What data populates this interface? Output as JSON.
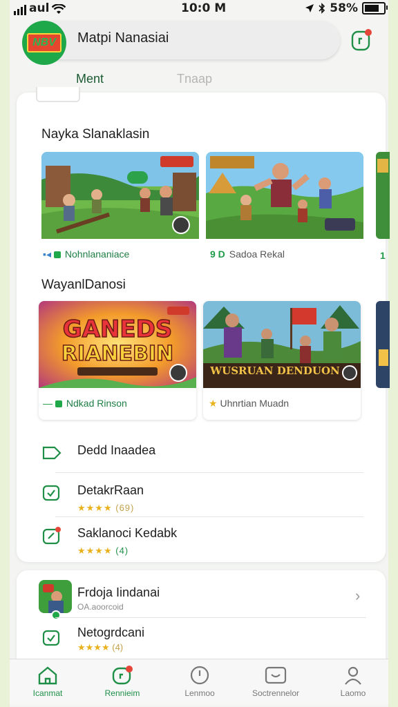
{
  "status_bar": {
    "carrier": "aul",
    "time": "10:0 M",
    "battery": "58%"
  },
  "header": {
    "title": "Matpi Nanasiai",
    "logo_text": "NBV"
  },
  "tabs": [
    {
      "label": "Ment",
      "active": true
    },
    {
      "label": "Tnaap",
      "active": false
    }
  ],
  "section1": {
    "title": "Nayka Slanaklasin",
    "tiles": [
      {
        "label": "Nohnlananiace",
        "badge": "GG",
        "style": "green"
      },
      {
        "label": "Sadoa Rekal",
        "prefix": "9 D",
        "style": "gray"
      }
    ],
    "partial_label": "1"
  },
  "section2": {
    "title": "WayanlDanosi",
    "tiles": [
      {
        "label": "Ndkad Rinson",
        "art_text_1": "GANEDS",
        "art_text_2": "RIANEBIN"
      },
      {
        "label": "Uhnrtian Muadn",
        "art_text": "WUSRUAN DENDUON"
      }
    ]
  },
  "list": [
    {
      "title": "Dedd Inaadea",
      "rating": ""
    },
    {
      "title": "DetakrRaan",
      "rating": "★★★★",
      "rating_suffix": "(69)"
    },
    {
      "title": "Saklanoci Kedabk",
      "rating": "★★★★",
      "rating_suffix": "(4)"
    }
  ],
  "card2": {
    "items": [
      {
        "title": "Frdoja Iindanai",
        "subtitle": "OA.aoorcoid"
      },
      {
        "title": "Netogrdcani",
        "rating": "★★★★",
        "rating_suffix": "(4)"
      }
    ]
  },
  "nav": [
    {
      "label": "Icanmat",
      "icon": "home-icon",
      "active": true
    },
    {
      "label": "Rennieim",
      "icon": "games-icon",
      "active": true
    },
    {
      "label": "Lenmoo",
      "icon": "clock-icon",
      "active": false
    },
    {
      "label": "Soctrennelor",
      "icon": "controller-icon",
      "active": false
    },
    {
      "label": "Laomo",
      "icon": "profile-icon",
      "active": false
    }
  ],
  "colors": {
    "accent": "#1fa84a",
    "star": "#e9b21c",
    "notification": "#e5463a"
  }
}
